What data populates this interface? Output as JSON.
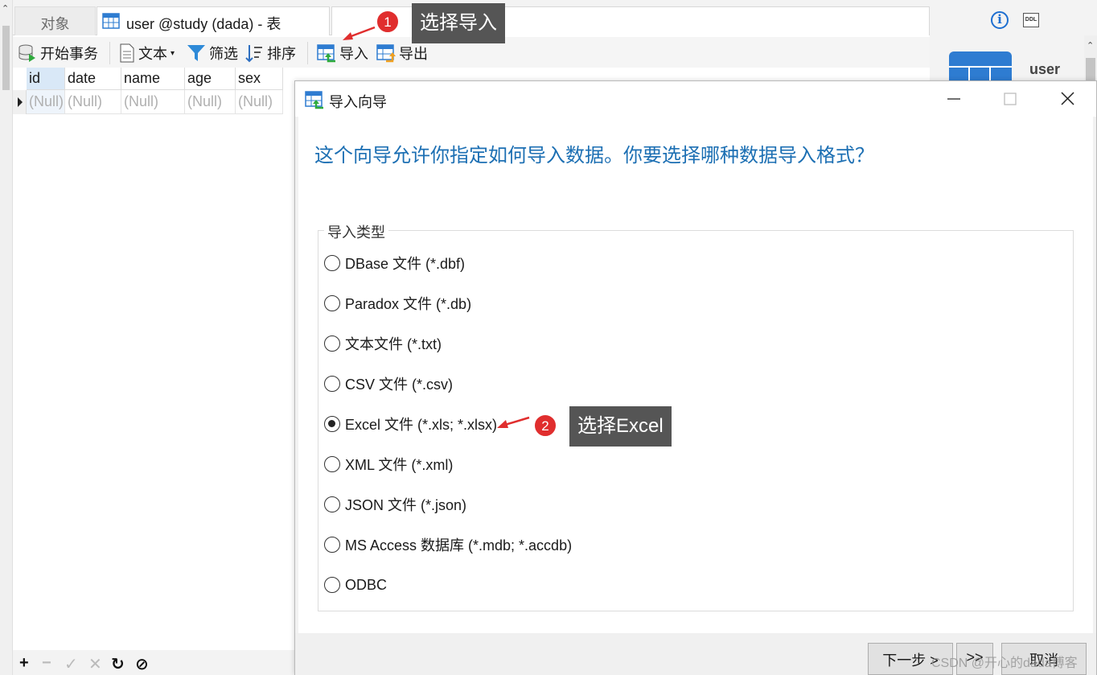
{
  "tabs": [
    {
      "label": "对象"
    },
    {
      "label": "user @study (dada) - 表"
    }
  ],
  "toolbar": {
    "begin_transaction": "开始事务",
    "text": "文本",
    "filter": "筛选",
    "sort": "排序",
    "import": "导入",
    "export": "导出"
  },
  "grid": {
    "columns": [
      "id",
      "date",
      "name",
      "age",
      "sex"
    ],
    "row": [
      "(Null)",
      "(Null)",
      "(Null)",
      "(Null)",
      "(Null)"
    ]
  },
  "right_panel": {
    "table_name": "user",
    "ddl_label": "DDL",
    "info_glyph": "i"
  },
  "callouts": {
    "step1_number": "1",
    "step1_text": "选择导入",
    "step2_number": "2",
    "step2_text": "选择Excel"
  },
  "dialog": {
    "title": "导入向导",
    "heading": "这个向导允许你指定如何导入数据。你要选择哪种数据导入格式？",
    "group_label": "导入类型",
    "options": [
      {
        "label": "DBase 文件 (*.dbf)",
        "selected": false
      },
      {
        "label": "Paradox 文件 (*.db)",
        "selected": false
      },
      {
        "label": "文本文件 (*.txt)",
        "selected": false
      },
      {
        "label": "CSV 文件 (*.csv)",
        "selected": false
      },
      {
        "label": "Excel 文件 (*.xls; *.xlsx)",
        "selected": true
      },
      {
        "label": "XML 文件 (*.xml)",
        "selected": false
      },
      {
        "label": "JSON 文件 (*.json)",
        "selected": false
      },
      {
        "label": "MS Access 数据库 (*.mdb; *.accdb)",
        "selected": false
      },
      {
        "label": "ODBC",
        "selected": false
      }
    ],
    "next_button": "下一步 >",
    "last_button": ">>",
    "cancel_button": "取消"
  },
  "watermark": "CSDN @开心的dada博客",
  "colors": {
    "accent_blue": "#1c6fb3",
    "badge_red": "#e02e2e",
    "callout_gray": "#555555"
  }
}
